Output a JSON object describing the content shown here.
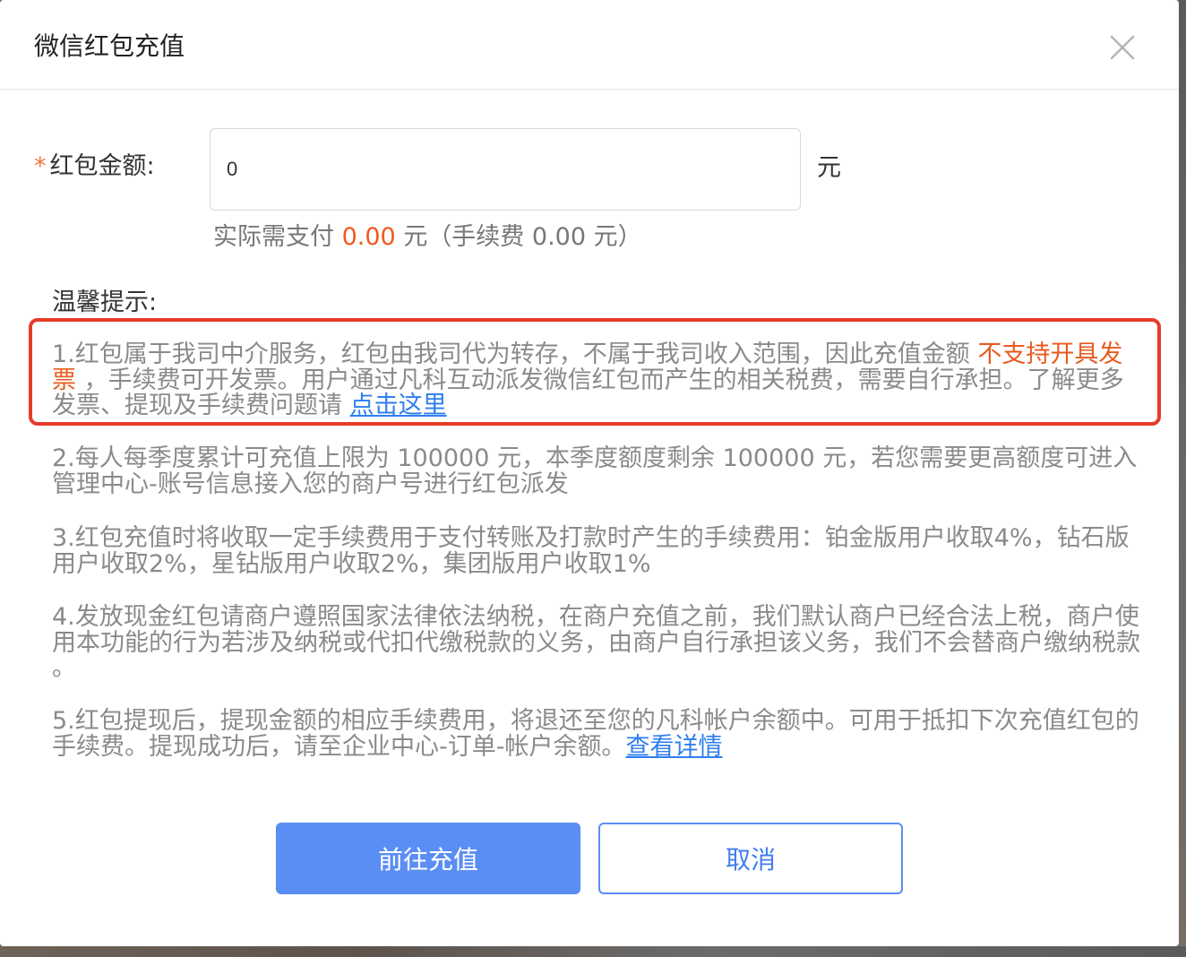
{
  "dialog": {
    "title": "微信红包充值",
    "close_icon": "close-icon"
  },
  "form": {
    "required_mark": "*",
    "amount_label": "红包金额:",
    "amount_value": "0",
    "unit": "元",
    "payment": {
      "prefix": "实际需支付",
      "amount": "0.00",
      "suffix": "元（手续费 0.00 元）"
    }
  },
  "tips": {
    "title": "温馨提示:",
    "tip1": {
      "text_a": "1.红包属于我司中介服务，红包由我司代为转存，不属于我司收入范围，因此充值金额 ",
      "warning": "不支持开具发票",
      "text_b": " ，手续费可开发票。用户通过凡科互动派发微信红包而产生的相关税费，需要自行承担。了解更多发票、提现及手续费问题请 ",
      "link": "点击这里"
    },
    "tip2": "2.每人每季度累计可充值上限为 100000 元，本季度额度剩余 100000 元，若您需要更高额度可进入管理中心-账号信息接入您的商户号进行红包派发",
    "tip3": "3.红包充值时将收取一定手续费用于支付转账及打款时产生的手续费用：铂金版用户收取4%，钻石版用户收取2%，星钻版用户收取2%，集团版用户收取1%",
    "tip4": "4.发放现金红包请商户遵照国家法律依法纳税，在商户充值之前，我们默认商户已经合法上税，商户使用本功能的行为若涉及纳税或代扣代缴税款的义务，由商户自行承担该义务，我们不会替商户缴纳税款 。",
    "tip5": {
      "text": "5.红包提现后，提现金额的相应手续费用，将退还至您的凡科帐户余额中。可用于抵扣下次充值红包的手续费。提现成功后，请至企业中心-订单-帐户余额。",
      "link": "查看详情"
    }
  },
  "buttons": {
    "confirm": "前往充值",
    "cancel": "取消"
  },
  "colors": {
    "primary": "#5b8ef5",
    "warning": "#e85a1e",
    "highlight_border": "#e53b2b",
    "link": "#2f7ef0"
  }
}
